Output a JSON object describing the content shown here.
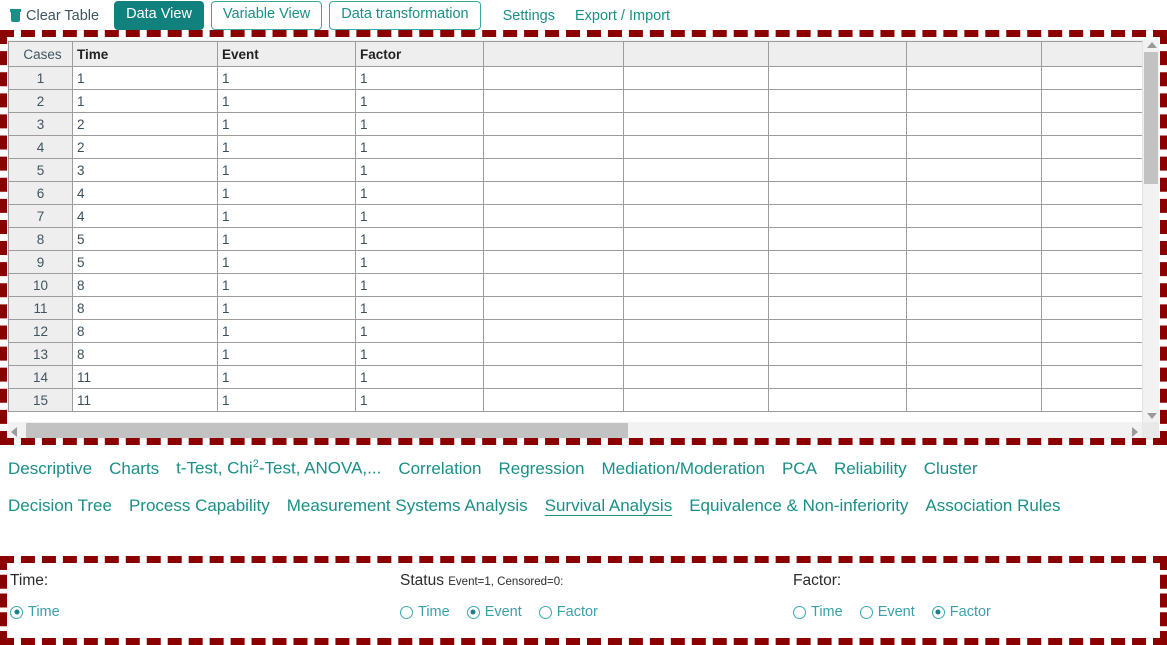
{
  "toolbar": {
    "clear_table": {
      "label": "Clear Table",
      "icon": "trash-icon"
    },
    "tabs": [
      {
        "label": "Data View",
        "active": true
      },
      {
        "label": "Variable View",
        "active": false
      },
      {
        "label": "Data transformation",
        "active": false
      }
    ],
    "links": [
      {
        "label": "Settings"
      },
      {
        "label": "Export / Import"
      }
    ]
  },
  "table": {
    "corner_label": "Cases",
    "headers": [
      "Time",
      "Event",
      "Factor",
      "",
      "",
      "",
      "",
      ""
    ],
    "rows": [
      {
        "case": "1",
        "cells": [
          "1",
          "1",
          "1",
          "",
          "",
          "",
          "",
          ""
        ]
      },
      {
        "case": "2",
        "cells": [
          "1",
          "1",
          "1",
          "",
          "",
          "",
          "",
          ""
        ]
      },
      {
        "case": "3",
        "cells": [
          "2",
          "1",
          "1",
          "",
          "",
          "",
          "",
          ""
        ]
      },
      {
        "case": "4",
        "cells": [
          "2",
          "1",
          "1",
          "",
          "",
          "",
          "",
          ""
        ]
      },
      {
        "case": "5",
        "cells": [
          "3",
          "1",
          "1",
          "",
          "",
          "",
          "",
          ""
        ]
      },
      {
        "case": "6",
        "cells": [
          "4",
          "1",
          "1",
          "",
          "",
          "",
          "",
          ""
        ]
      },
      {
        "case": "7",
        "cells": [
          "4",
          "1",
          "1",
          "",
          "",
          "",
          "",
          ""
        ]
      },
      {
        "case": "8",
        "cells": [
          "5",
          "1",
          "1",
          "",
          "",
          "",
          "",
          ""
        ]
      },
      {
        "case": "9",
        "cells": [
          "5",
          "1",
          "1",
          "",
          "",
          "",
          "",
          ""
        ]
      },
      {
        "case": "10",
        "cells": [
          "8",
          "1",
          "1",
          "",
          "",
          "",
          "",
          ""
        ]
      },
      {
        "case": "11",
        "cells": [
          "8",
          "1",
          "1",
          "",
          "",
          "",
          "",
          ""
        ]
      },
      {
        "case": "12",
        "cells": [
          "8",
          "1",
          "1",
          "",
          "",
          "",
          "",
          ""
        ]
      },
      {
        "case": "13",
        "cells": [
          "8",
          "1",
          "1",
          "",
          "",
          "",
          "",
          ""
        ]
      },
      {
        "case": "14",
        "cells": [
          "11",
          "1",
          "1",
          "",
          "",
          "",
          "",
          ""
        ]
      },
      {
        "case": "15",
        "cells": [
          "11",
          "1",
          "1",
          "",
          "",
          "",
          "",
          ""
        ]
      }
    ]
  },
  "analysis_menu": {
    "row1": [
      {
        "label": "Descriptive",
        "active": false
      },
      {
        "label": "Charts",
        "active": false
      },
      {
        "label": "t-Test, Chi",
        "sup": "2",
        "label_tail": "-Test, ANOVA,...",
        "active": false
      },
      {
        "label": "Correlation",
        "active": false
      },
      {
        "label": "Regression",
        "active": false
      },
      {
        "label": "Mediation/Moderation",
        "active": false
      },
      {
        "label": "PCA",
        "active": false
      },
      {
        "label": "Reliability",
        "active": false
      },
      {
        "label": "Cluster",
        "active": false
      }
    ],
    "row2": [
      {
        "label": "Decision Tree",
        "active": false
      },
      {
        "label": "Process Capability",
        "active": false
      },
      {
        "label": "Measurement Systems Analysis",
        "active": false
      },
      {
        "label": "Survival Analysis",
        "active": true
      },
      {
        "label": "Equivalence & Non-inferiority",
        "active": false
      },
      {
        "label": "Association Rules",
        "active": false
      }
    ]
  },
  "variable_selector": {
    "time": {
      "title": "Time:",
      "options": [
        {
          "label": "Time",
          "checked": true
        }
      ]
    },
    "status": {
      "title": "Status",
      "subtitle": "Event=1, Censored=0:",
      "options": [
        {
          "label": "Time",
          "checked": false
        },
        {
          "label": "Event",
          "checked": true
        },
        {
          "label": "Factor",
          "checked": false
        }
      ]
    },
    "factor": {
      "title": "Factor:",
      "options": [
        {
          "label": "Time",
          "checked": false
        },
        {
          "label": "Event",
          "checked": false
        },
        {
          "label": "Factor",
          "checked": true
        }
      ]
    }
  },
  "colors": {
    "accent_teal": "#1a8f87",
    "accent_teal_dark": "#10817c",
    "radio_teal": "#3aa0a8",
    "highlight_red": "#8B0000",
    "cell_text": "#3a4f5c"
  }
}
